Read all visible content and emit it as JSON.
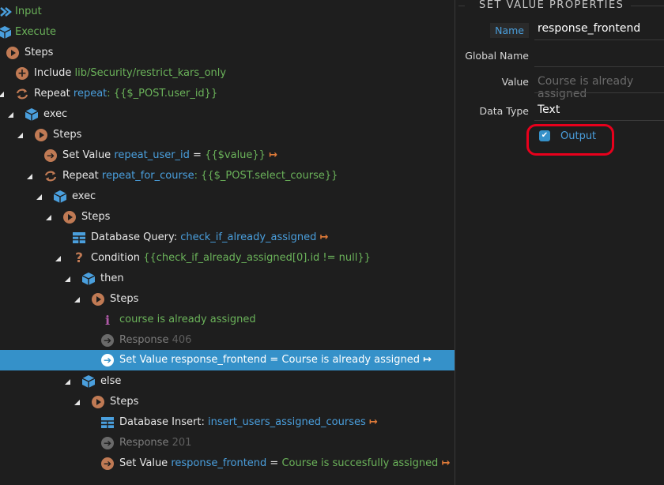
{
  "tree": {
    "input": "Input",
    "execute": "Execute",
    "steps_root": "Steps",
    "include": {
      "keyword": "Include",
      "path": "lib/Security/restrict_kars_only"
    },
    "repeat1": {
      "keyword": "Repeat",
      "name": "repeat",
      "expr": ": {{$_POST.user_id}}"
    },
    "exec1": "exec",
    "steps2": "Steps",
    "setvalue1": {
      "keyword": "Set Value",
      "name": "repeat_user_id",
      "eq": " = ",
      "expr": "{{$value}}"
    },
    "repeat2": {
      "keyword": "Repeat",
      "name": "repeat_for_course",
      "expr": ": {{$_POST.select_course}}"
    },
    "exec2": "exec",
    "steps3": "Steps",
    "dbquery": {
      "keyword": "Database Query:",
      "name": "check_if_already_assigned"
    },
    "condition": {
      "keyword": "Condition",
      "expr": "{{check_if_already_assigned[0].id != null}}"
    },
    "then": "then",
    "steps4": "Steps",
    "comment": "course is already assigned",
    "response1": {
      "keyword": "Response",
      "code": "406"
    },
    "setvalue2": "Set Value response_frontend = Course is already assigned",
    "else": "else",
    "steps5": "Steps",
    "dbinsert": {
      "keyword": "Database Insert:",
      "name": "insert_users_assigned_courses"
    },
    "response2": {
      "keyword": "Response",
      "code": "201"
    },
    "setvalue3": {
      "keyword": "Set Value",
      "name": "response_frontend",
      "eq": " = ",
      "value": "Course is succesfully assigned"
    }
  },
  "properties": {
    "title": "SET VALUE PROPERTIES",
    "name_label": "Name",
    "name_value": "response_frontend",
    "global_name_label": "Global Name",
    "global_name_value": "",
    "value_label": "Value",
    "value_value": "Course is already assigned",
    "data_type_label": "Data Type",
    "data_type_value": "Text",
    "output_label": "Output",
    "output_checked": true
  },
  "colors": {
    "selected_row": "#3591c9",
    "green_text": "#6bb35a",
    "blue_text": "#4a9fdd",
    "step_icon": "#c07a54",
    "highlight": "#e8001c"
  },
  "icons": [
    "input-icon",
    "cube-icon",
    "steps-icon",
    "plus-icon",
    "repeat-icon",
    "set-value-icon",
    "table-icon",
    "question-icon",
    "info-icon",
    "response-icon",
    "exit-icon",
    "checkbox-icon"
  ]
}
